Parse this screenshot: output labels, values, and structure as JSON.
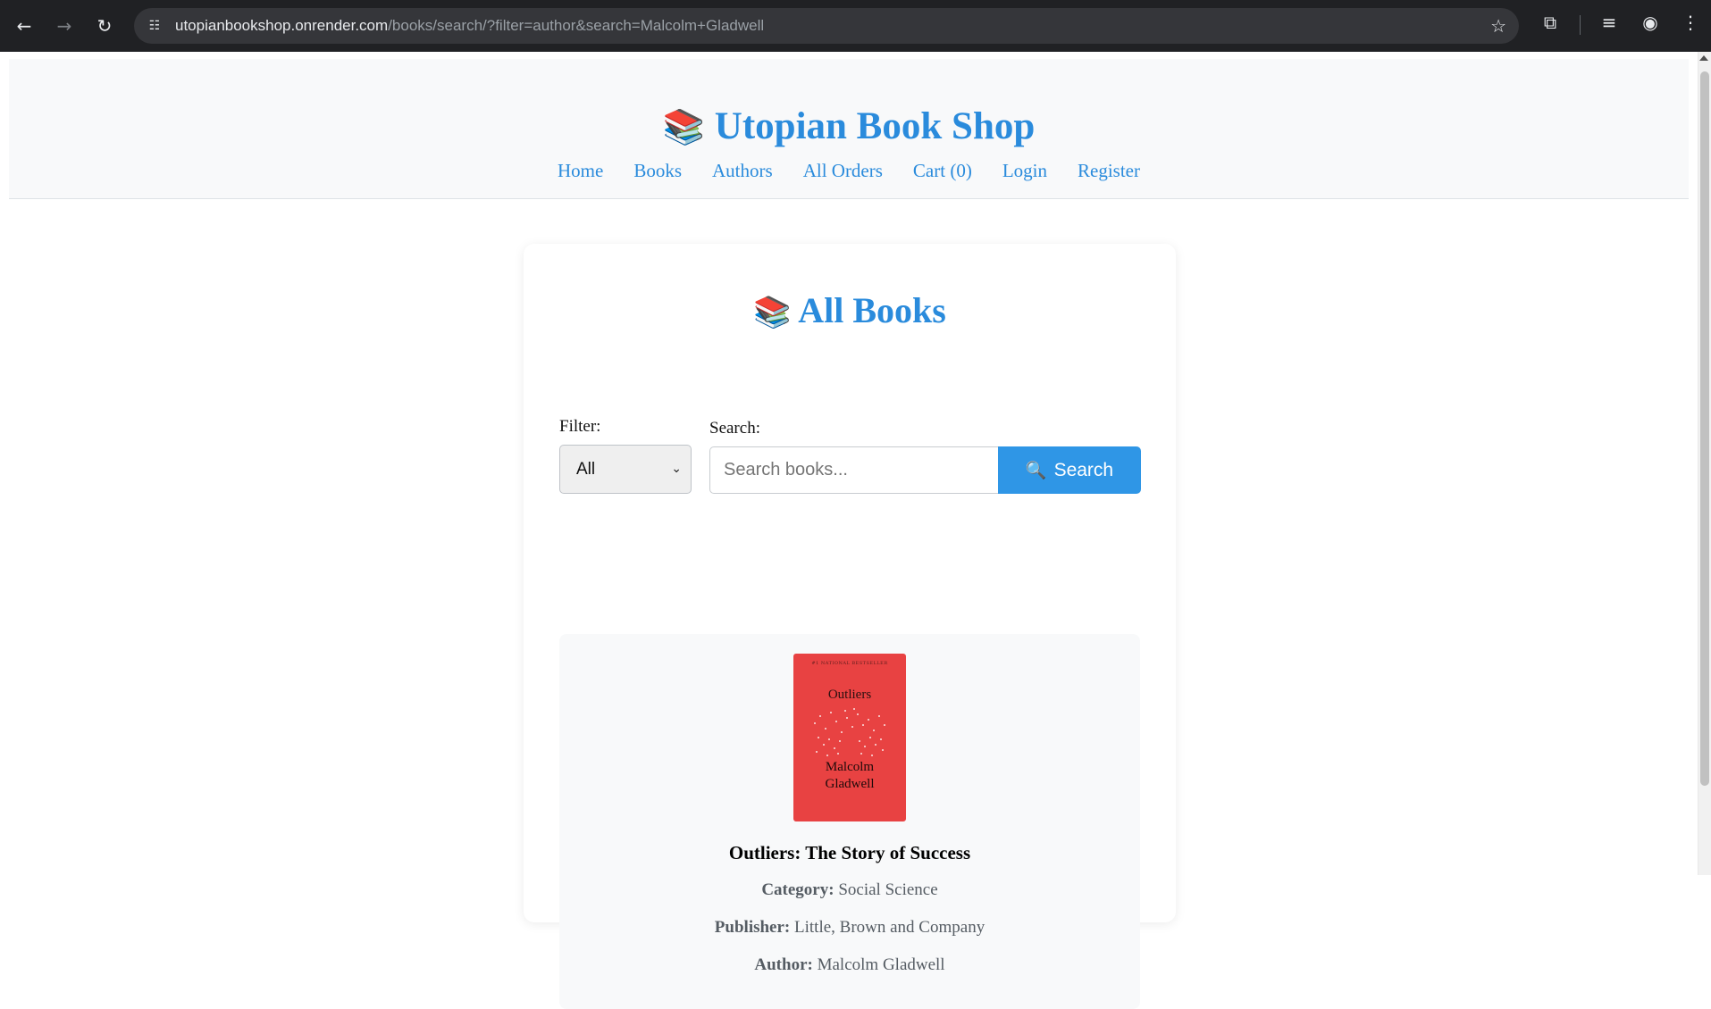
{
  "browser": {
    "url_host": "utopianbookshop.onrender.com",
    "url_path": "/books/search/?filter=author&search=Malcolm+Gladwell",
    "icons": [
      "back-icon",
      "forward-icon",
      "reload-icon",
      "site-info-icon",
      "bookmark-star-icon",
      "extensions-icon",
      "media-controls-icon",
      "profile-icon",
      "menu-icon"
    ]
  },
  "site": {
    "title": "Utopian Book Shop",
    "title_emoji": "📚",
    "brand_color": "#2a8bdc",
    "nav": {
      "home": "Home",
      "books": "Books",
      "authors": "Authors",
      "orders": "All Orders",
      "cart": "Cart (0)",
      "login": "Login",
      "register": "Register"
    }
  },
  "main": {
    "heading": "All Books",
    "heading_emoji": "📚",
    "filter_label": "Filter:",
    "filter_value": "All",
    "search_label": "Search:",
    "search_placeholder": "Search books...",
    "search_button": "Search",
    "search_icon": "🔍"
  },
  "books": [
    {
      "title": "Outliers: The Story of Success",
      "category_label": "Category:",
      "category": "Social Science",
      "publisher_label": "Publisher:",
      "publisher": "Little, Brown and Company",
      "author_label": "Author:",
      "author": "Malcolm Gladwell",
      "cover": {
        "color": "#e84242",
        "top_line": "#1 NATIONAL BESTSELLER",
        "title": "Outliers",
        "author_line1": "Malcolm",
        "author_line2": "Gladwell"
      }
    }
  ]
}
